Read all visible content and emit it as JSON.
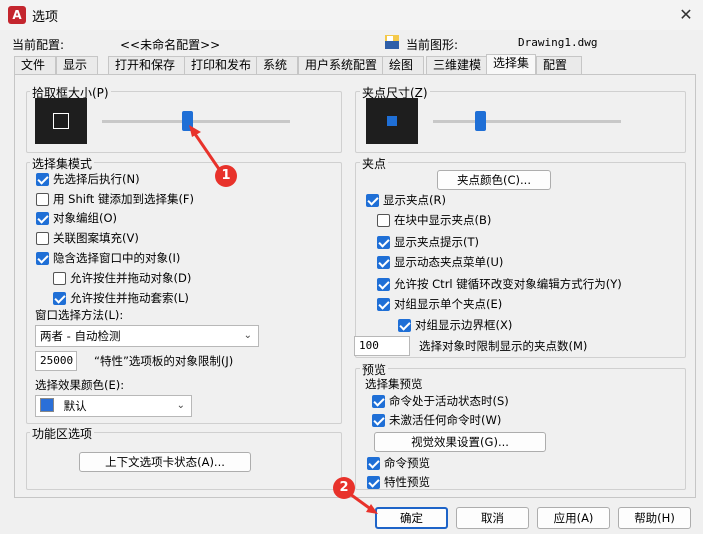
{
  "window": {
    "title": "选项",
    "close": "✕"
  },
  "header": {
    "profile_label": "当前配置:",
    "profile_value": "<<未命名配置>>",
    "drawing_label": "当前图形:",
    "drawing_value": "Drawing1.dwg"
  },
  "tabs": [
    "文件",
    "显示",
    "打开和保存",
    "打印和发布",
    "系统",
    "用户系统配置",
    "绘图",
    "三维建模",
    "选择集",
    "配置"
  ],
  "pickbox": {
    "title": "拾取框大小(P)",
    "slider_fraction": 0.45
  },
  "grip_size": {
    "title": "夹点尺寸(Z)",
    "slider_fraction": 0.25
  },
  "selection_modes": {
    "title": "选择集模式",
    "items": [
      {
        "label": "先选择后执行(N)",
        "checked": true
      },
      {
        "label": "用 Shift 键添加到选择集(F)",
        "checked": false
      },
      {
        "label": "对象编组(O)",
        "checked": true
      },
      {
        "label": "关联图案填充(V)",
        "checked": false
      },
      {
        "label": "隐含选择窗口中的对象(I)",
        "checked": true
      },
      {
        "label": "允许按住并拖动对象(D)",
        "checked": false
      },
      {
        "label": "允许按住并拖动套索(L)",
        "checked": true
      }
    ],
    "window_method_label": "窗口选择方法(L):",
    "window_method_value": "两者 - 自动检测",
    "limit_value": "25000",
    "limit_label": "“特性”选项板的对象限制(J)",
    "effect_color_label": "选择效果颜色(E):",
    "effect_color_value": "默认",
    "effect_color_swatch": "#2a6fd8"
  },
  "ribbon": {
    "title": "功能区选项",
    "button": "上下文选项卡状态(A)..."
  },
  "grips": {
    "title": "夹点",
    "color_button": "夹点颜色(C)...",
    "items": [
      {
        "label": "显示夹点(R)",
        "checked": true
      },
      {
        "label": "在块中显示夹点(B)",
        "checked": false
      },
      {
        "label": "显示夹点提示(T)",
        "checked": true
      },
      {
        "label": "显示动态夹点菜单(U)",
        "checked": true
      },
      {
        "label": "允许按 Ctrl 键循环改变对象编辑方式行为(Y)",
        "checked": true
      },
      {
        "label": "对组显示单个夹点(E)",
        "checked": true
      },
      {
        "label": "对组显示边界框(X)",
        "checked": true
      }
    ],
    "limit_value": "100",
    "limit_label": "选择对象时限制显示的夹点数(M)"
  },
  "preview": {
    "title": "预览",
    "subtitle": "选择集预览",
    "items": [
      {
        "label": "命令处于活动状态时(S)",
        "checked": true
      },
      {
        "label": "未激活任何命令时(W)",
        "checked": true
      }
    ],
    "effect_button": "视觉效果设置(G)...",
    "cmd_preview": {
      "label": "命令预览",
      "checked": true
    },
    "prop_preview": {
      "label": "特性预览",
      "checked": true
    }
  },
  "footer": {
    "ok": "确定",
    "cancel": "取消",
    "apply": "应用(A)",
    "help": "帮助(H)"
  },
  "annotations": {
    "badge1": "1",
    "badge2": "2",
    "color": "#e8322b"
  }
}
